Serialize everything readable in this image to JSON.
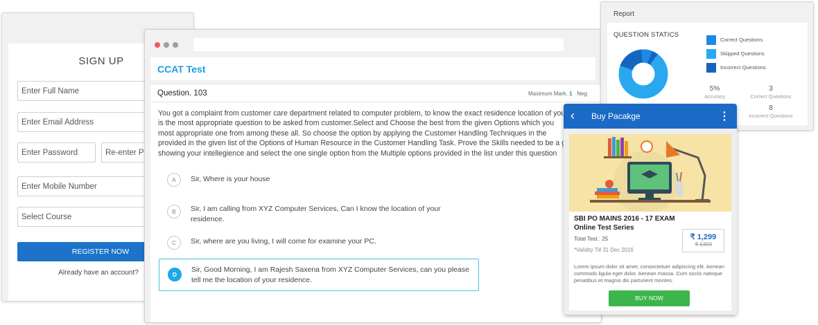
{
  "signup": {
    "title": "SIGN UP",
    "full_name_placeholder": "Enter Full Name",
    "email_placeholder": "Enter Email Address",
    "password_placeholder": "Enter Password",
    "reenter_password_placeholder": "Re-enter Pas",
    "mobile_placeholder": "Enter Mobile Number",
    "course_placeholder": "Select Course",
    "register_label": "REGISTER NOW",
    "already_text": "Already have an account?"
  },
  "test": {
    "title": "CCAT Test",
    "question_number": "Question. 103",
    "max_mark_label": "Maximum Mark.",
    "max_mark_value": "1",
    "negative_label": "Neg",
    "question_text": "You got a complaint from customer care department related to computer problem, to know the exact residence location of you\nis the most appropriate question to be asked from customer.Select and Choose the best from the given Options which you \nmost appropriate one from among these all. So choose the option by applying the Customer Handling Techniques in the\nprovided in the given list of the Options of Human Resource in the Customer Handling Task. Prove the Skills needed to be a g\nshowing your intellegience and select the one single option from the Multiple options provided in the list under this question",
    "options": [
      {
        "letter": "A",
        "text": "Sir, Where is your house"
      },
      {
        "letter": "B",
        "text": "Sir, I am calling from XYZ Computer Services, Can I know the location of your\nresidence."
      },
      {
        "letter": "C",
        "text": "Sir, where are you living, I will come for examine your PC."
      },
      {
        "letter": "D",
        "text": "Sir, Good Morning, I am Rajesh Saxena from XYZ Computer Services, can you please\ntell me the location of your residence."
      }
    ],
    "dot_colors": [
      "#ee5b5b",
      "#9e9e9e",
      "#9e9e9e"
    ]
  },
  "report": {
    "title": "Report",
    "stat_title": "QUESTION STATICS",
    "legend": [
      {
        "label": "Correct Questions",
        "color": "#1e88e5"
      },
      {
        "label": "Skipped Questions",
        "color": "#29a8f0"
      },
      {
        "label": "Incorrect Questions",
        "color": "#1565c0"
      }
    ],
    "stats": [
      {
        "value": "5%",
        "label": "Accuracy"
      },
      {
        "value": "3",
        "label": "Correct Questions"
      },
      {
        "value": "8",
        "label": "Incorrect Questions"
      }
    ]
  },
  "buy": {
    "title": "Buy Pacakge",
    "package_name": "SBI PO MAINS 2016 - 17 EXAM Online Test Series",
    "total_test": "Total Test : 25",
    "validity": "*Validity Till 31 Dec 2016",
    "price": "₹ 1,299",
    "old_price": "₹ 1359",
    "description": "Lorem ipsum dolor sit amet, consectetuer adipiscing elit. Aenean commodo ligula eget dolor. Aenean massa. Cum sociis natoque penatibus et magnis dis parturient montes.",
    "buy_label": "BUY NOW",
    "accent": "#1b6ac6",
    "buy_color": "#3cb54a"
  }
}
